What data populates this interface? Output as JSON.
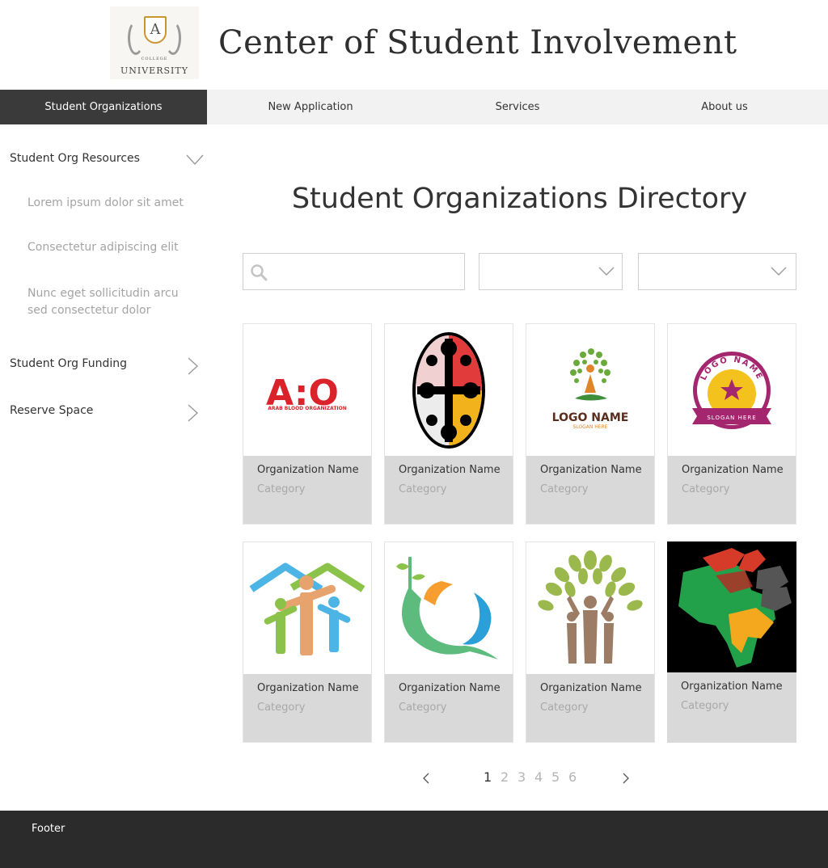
{
  "header": {
    "logo_letter": "A",
    "logo_small_text": "COLLEGE",
    "logo_text": "UNIVERSITY",
    "site_title": "Center of Student Involvement"
  },
  "nav": {
    "items": [
      {
        "label": "Student Organizations",
        "active": true
      },
      {
        "label": "New Application",
        "active": false
      },
      {
        "label": "Services",
        "active": false
      },
      {
        "label": "About us",
        "active": false
      }
    ]
  },
  "sidebar": {
    "resources": {
      "label": "Student Org Resources",
      "expanded": true,
      "subitems": [
        "Lorem ipsum dolor sit amet",
        "Consectetur adipiscing elit",
        "Nunc eget sollicitudin arcu sed consectetur dolor"
      ]
    },
    "funding": {
      "label": "Student Org Funding",
      "expanded": false
    },
    "reserve": {
      "label": "Reserve Space",
      "expanded": false
    }
  },
  "main": {
    "title": "Student Organizations Directory",
    "search": {
      "value": "",
      "placeholder": ""
    },
    "filters": [
      {
        "selected": ""
      },
      {
        "selected": ""
      }
    ]
  },
  "cards": [
    {
      "name": "Organization Name",
      "category": "Category",
      "logo": "abo-logo",
      "logo_text": "A:O",
      "logo_subtext": "ARAB BLOOD ORGANIZATION"
    },
    {
      "name": "Organization Name",
      "category": "Category",
      "logo": "tribal-oval-logo"
    },
    {
      "name": "Organization Name",
      "category": "Category",
      "logo": "tree-person-logo",
      "logo_text": "LOGO NAME",
      "logo_subtext": "SLOGAN HERE"
    },
    {
      "name": "Organization Name",
      "category": "Category",
      "logo": "circle-badge-logo",
      "logo_text": "LOGO NAME",
      "logo_subtext": "SLOGAN HERE"
    },
    {
      "name": "Organization Name",
      "category": "Category",
      "logo": "people-house-logo"
    },
    {
      "name": "Organization Name",
      "category": "Category",
      "logo": "q-wave-logo"
    },
    {
      "name": "Organization Name",
      "category": "Category",
      "logo": "tree-people-logo"
    },
    {
      "name": "Organization Name",
      "category": "Category",
      "logo": "africa-fist-logo"
    }
  ],
  "pagination": {
    "pages": [
      "1",
      "2",
      "3",
      "4",
      "5",
      "6"
    ],
    "current": "1"
  },
  "footer": {
    "label": "Footer"
  },
  "colors": {
    "nav_active": "#3a3a3a",
    "nav_bg": "#f2f2f2",
    "card_info_bg": "#d9d9d9",
    "footer_bg": "#2b2b2b",
    "muted_text": "#a4a4a4"
  }
}
